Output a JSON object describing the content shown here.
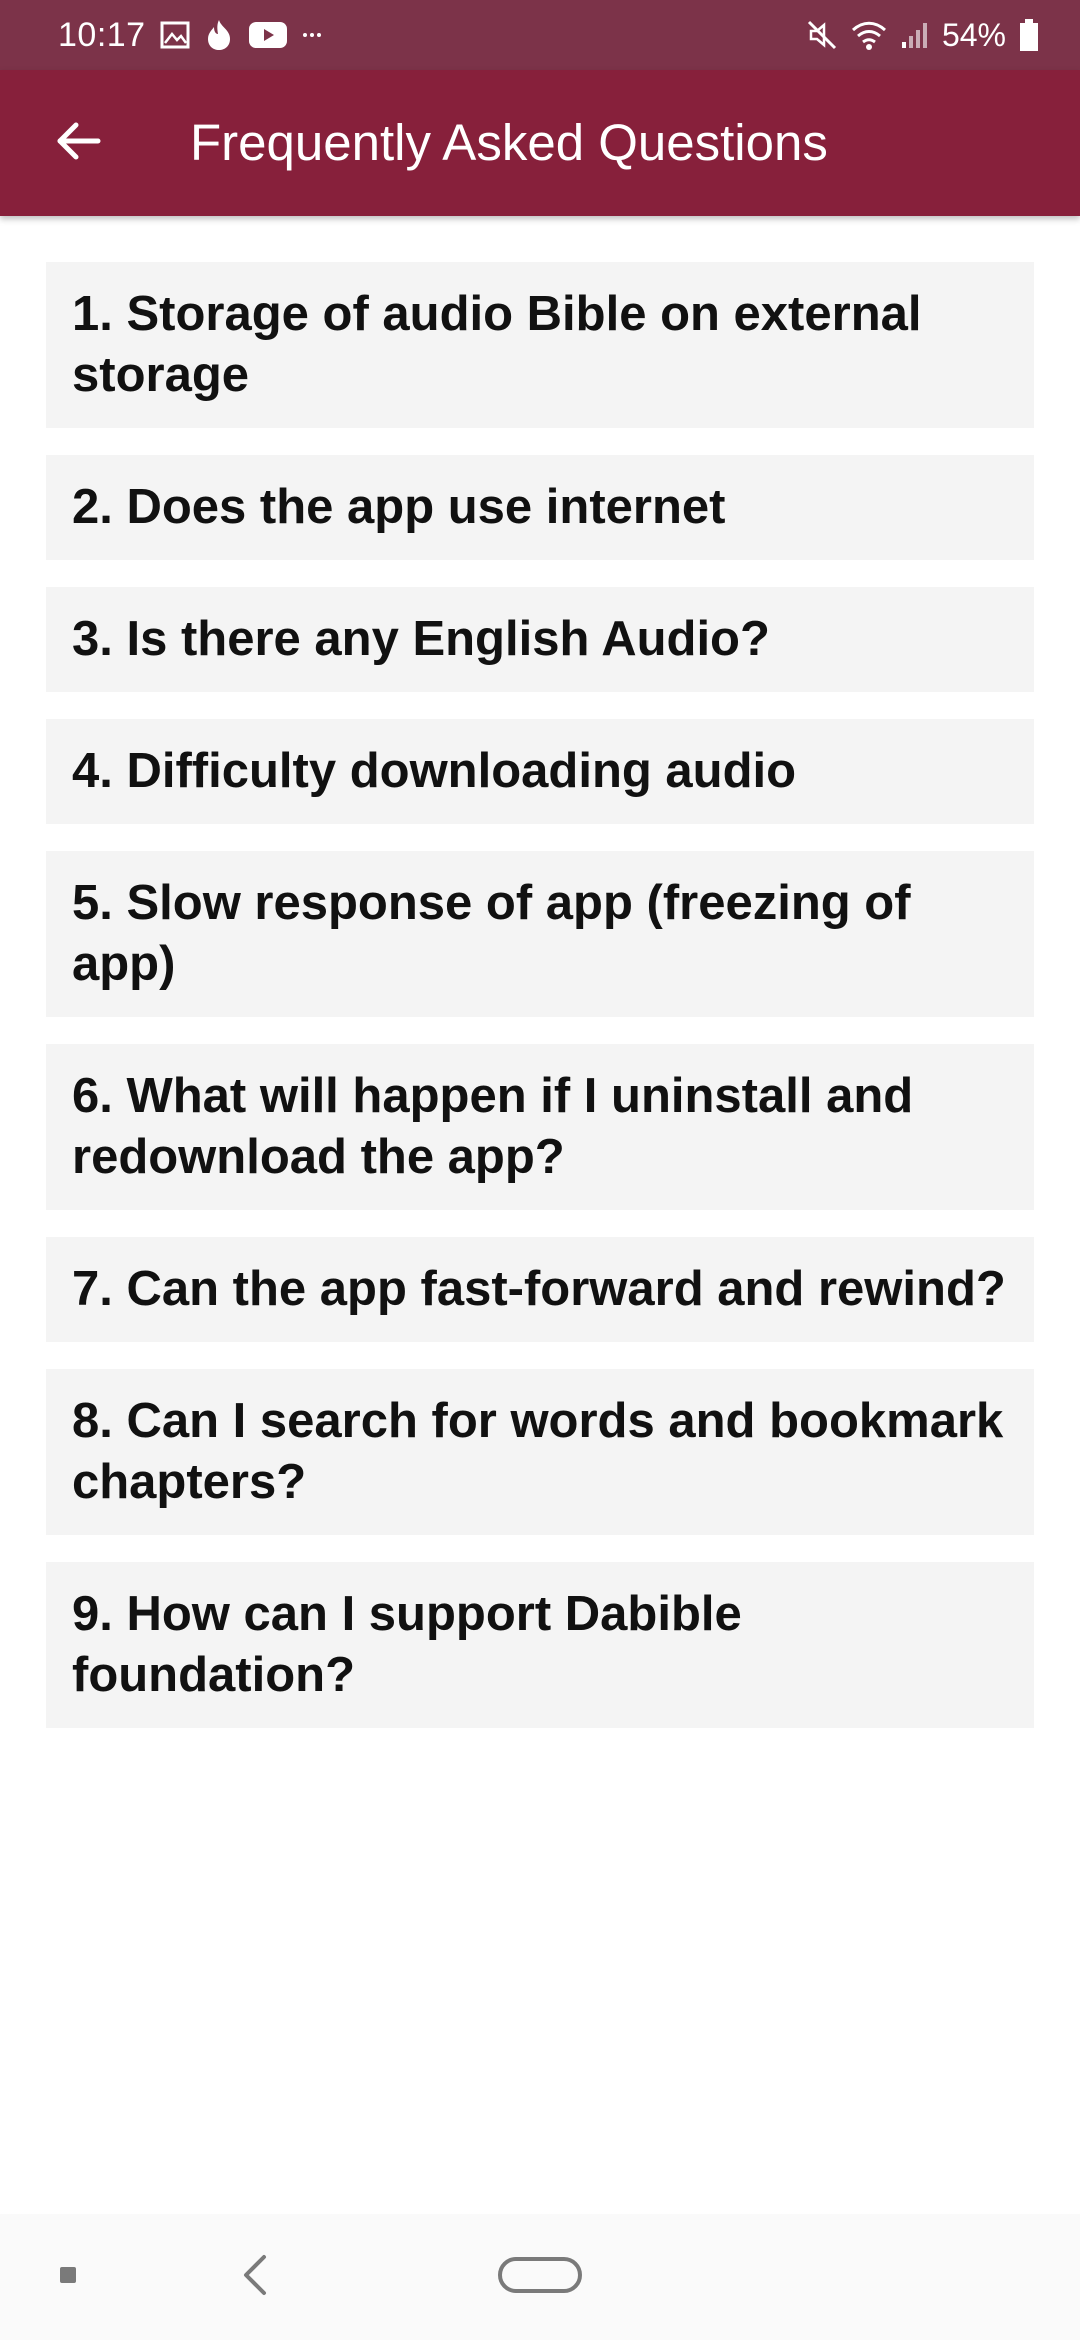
{
  "status_bar": {
    "time": "10:17",
    "battery": "54%",
    "notification_icons": [
      "image-icon",
      "tinder-flame-icon",
      "youtube-icon",
      "more-dots-icon"
    ],
    "system_icons": [
      "mute-icon",
      "wifi-icon",
      "signal-icon",
      "battery-icon"
    ]
  },
  "app_bar": {
    "title": "Frequently Asked Questions",
    "back_icon": "arrow-left-icon"
  },
  "faq": {
    "items": [
      {
        "label": "1. Storage of audio Bible on external storage"
      },
      {
        "label": "2. Does the app use internet"
      },
      {
        "label": "3. Is there any English Audio?"
      },
      {
        "label": "4. Difficulty downloading audio"
      },
      {
        "label": "5. Slow response of app (freezing of app)"
      },
      {
        "label": "6. What will happen if I uninstall and redownload the app?"
      },
      {
        "label": "7. Can the app fast-forward and rewind?"
      },
      {
        "label": "8. Can I search for words and bookmark chapters?"
      },
      {
        "label": "9. How can I support Dabible foundation?"
      }
    ]
  },
  "nav_bar": {
    "buttons": [
      "recents-icon",
      "back-icon",
      "home-icon"
    ]
  },
  "colors": {
    "status_bar": "#7c3349",
    "app_bar": "#87203b",
    "item_background": "#f4f4f4",
    "text": "#111111"
  }
}
